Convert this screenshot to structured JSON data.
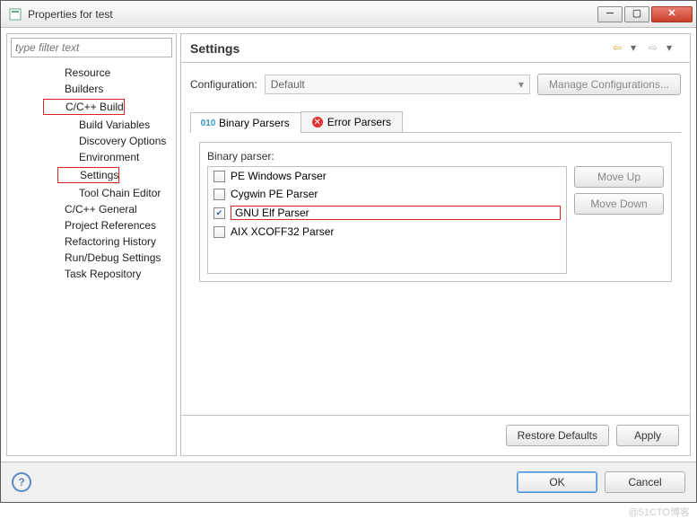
{
  "window": {
    "title": "Properties for test"
  },
  "filter": {
    "placeholder": "type filter text"
  },
  "tree": {
    "resource": "Resource",
    "builders": "Builders",
    "ccbuild": "C/C++ Build",
    "buildvars": "Build Variables",
    "discovery": "Discovery Options",
    "environment": "Environment",
    "settings": "Settings",
    "toolchain": "Tool Chain Editor",
    "ccgeneral": "C/C++ General",
    "projectrefs": "Project References",
    "refactoring": "Refactoring History",
    "rundebug": "Run/Debug Settings",
    "taskrepo": "Task Repository"
  },
  "header": {
    "title": "Settings"
  },
  "config": {
    "label": "Configuration:",
    "value": "Default",
    "manage": "Manage Configurations..."
  },
  "tabs": {
    "binary": "Binary Parsers",
    "error": "Error Parsers"
  },
  "parsers": {
    "groupLabel": "Binary parser:",
    "items": [
      {
        "label": "PE Windows Parser",
        "checked": false,
        "hl": false
      },
      {
        "label": "Cygwin PE Parser",
        "checked": false,
        "hl": false
      },
      {
        "label": "GNU Elf Parser",
        "checked": true,
        "hl": true
      },
      {
        "label": "AIX XCOFF32 Parser",
        "checked": false,
        "hl": false
      }
    ],
    "moveUp": "Move Up",
    "moveDown": "Move Down"
  },
  "buttons": {
    "restore": "Restore Defaults",
    "apply": "Apply",
    "ok": "OK",
    "cancel": "Cancel"
  },
  "watermark": "@51CTO博客"
}
